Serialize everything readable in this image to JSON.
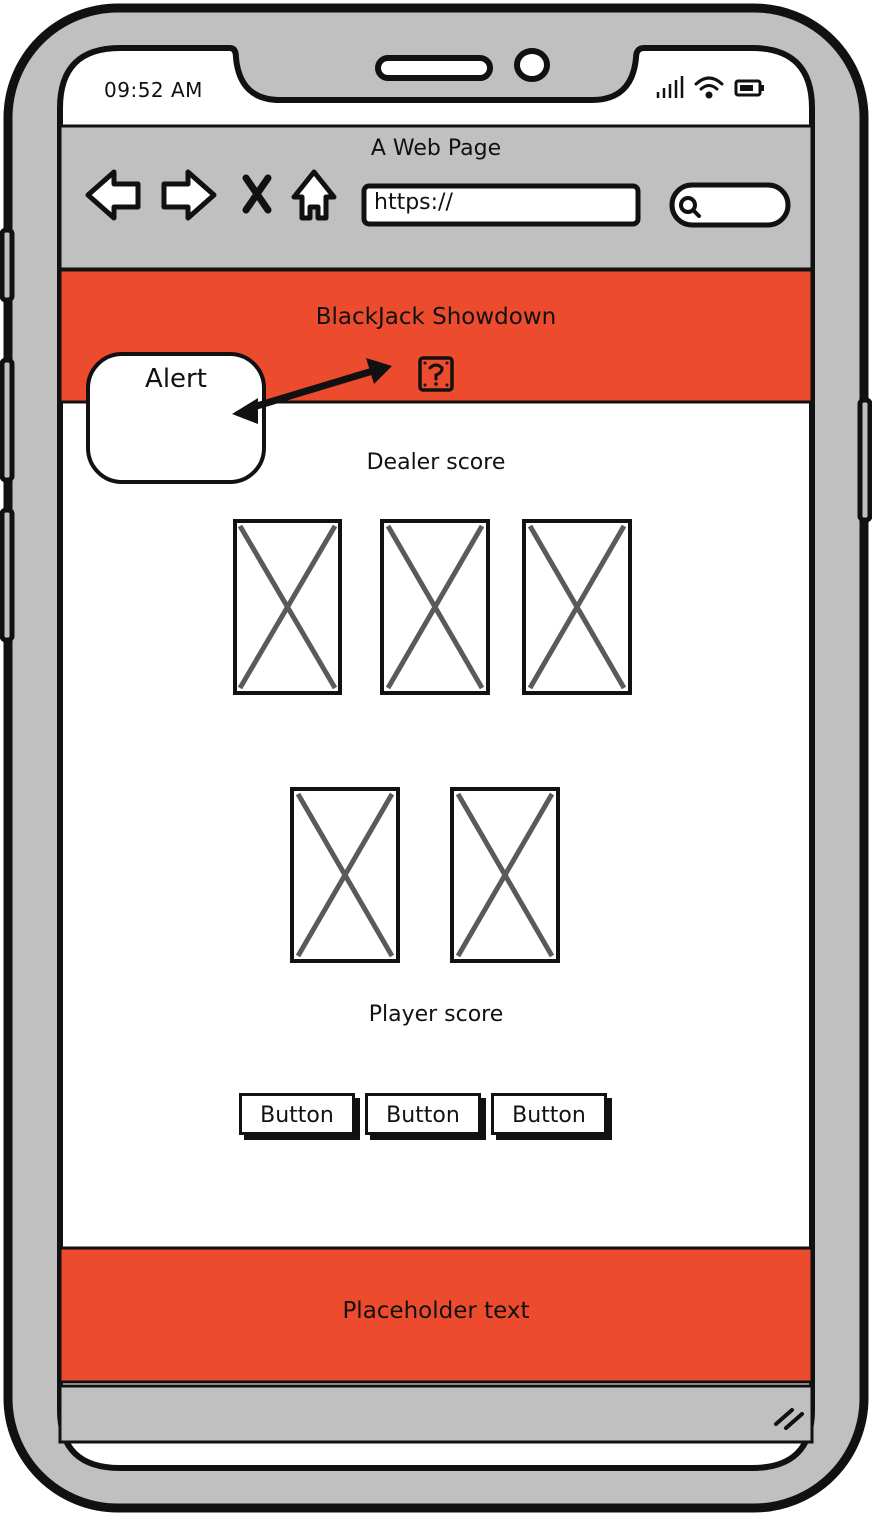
{
  "status_bar": {
    "time": "09:52 AM"
  },
  "browser": {
    "page_title": "A Web Page",
    "url": "https://",
    "icons": {
      "back": "back-arrow-icon",
      "forward": "forward-arrow-icon",
      "stop": "close-x-icon",
      "home": "home-icon",
      "search": "search-icon"
    }
  },
  "app": {
    "header_title": "BlackJack Showdown",
    "help_icon": "help-question-icon",
    "alert_label": "Alert",
    "dealer_label": "Dealer score",
    "player_label": "Player score",
    "dealer_cards": 3,
    "player_cards": 2,
    "buttons": [
      {
        "label": "Button"
      },
      {
        "label": "Button"
      },
      {
        "label": "Button"
      }
    ],
    "footer_text": "Placeholder text"
  },
  "colors": {
    "accent": "#EC4C2D",
    "frame_gray": "#C0C0C0",
    "ink": "#111111",
    "placeholder_x": "#5a5a5a"
  }
}
